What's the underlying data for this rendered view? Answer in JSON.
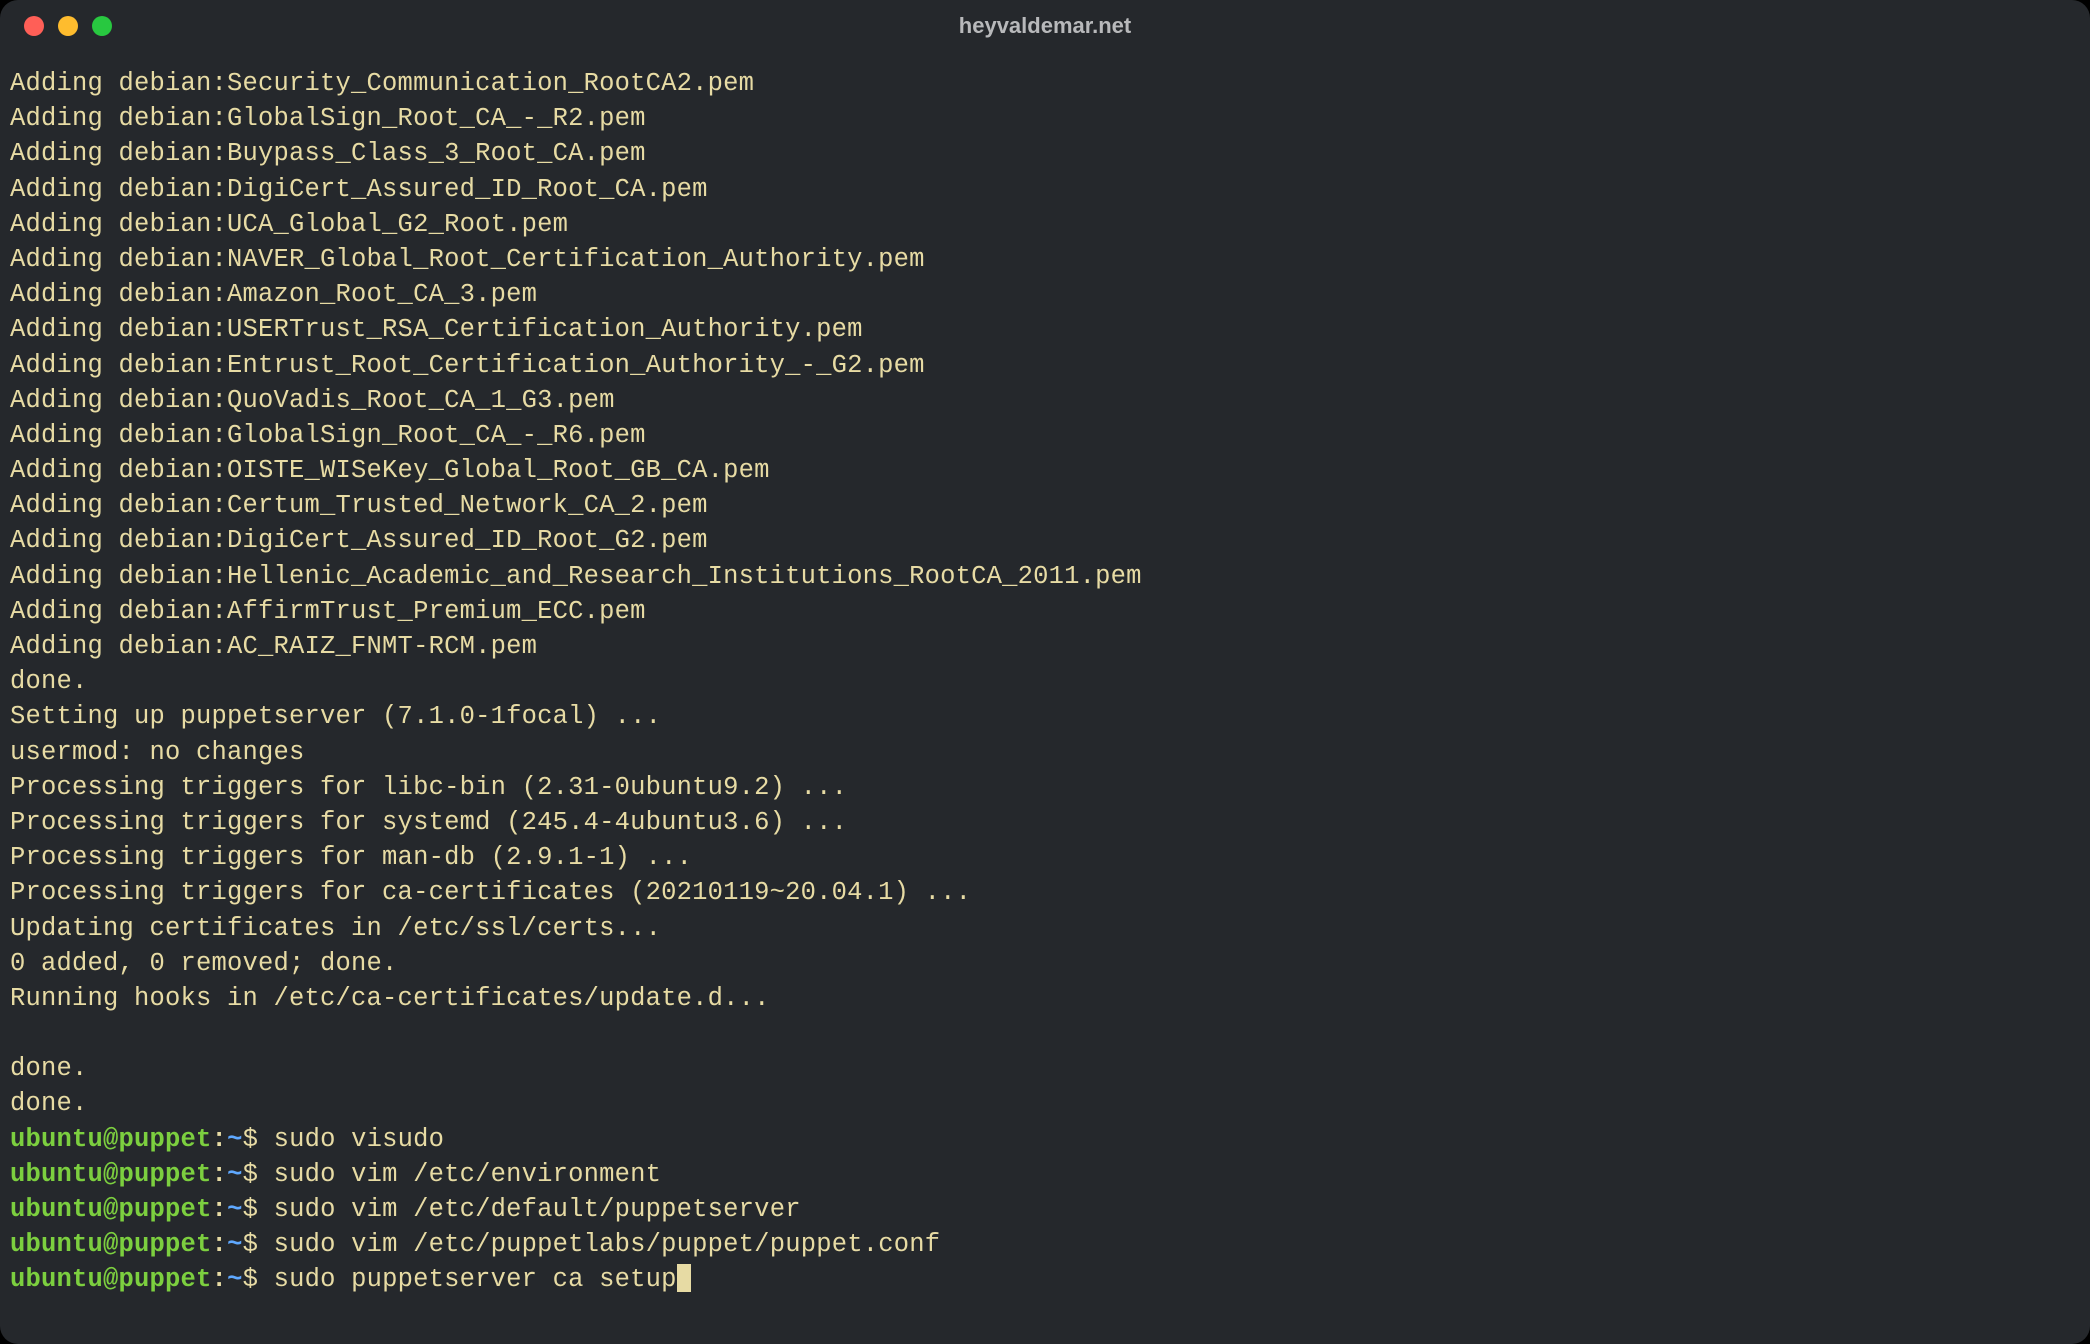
{
  "window": {
    "title": "heyvaldemar.net"
  },
  "output_lines": [
    "Adding debian:Security_Communication_RootCA2.pem",
    "Adding debian:GlobalSign_Root_CA_-_R2.pem",
    "Adding debian:Buypass_Class_3_Root_CA.pem",
    "Adding debian:DigiCert_Assured_ID_Root_CA.pem",
    "Adding debian:UCA_Global_G2_Root.pem",
    "Adding debian:NAVER_Global_Root_Certification_Authority.pem",
    "Adding debian:Amazon_Root_CA_3.pem",
    "Adding debian:USERTrust_RSA_Certification_Authority.pem",
    "Adding debian:Entrust_Root_Certification_Authority_-_G2.pem",
    "Adding debian:QuoVadis_Root_CA_1_G3.pem",
    "Adding debian:GlobalSign_Root_CA_-_R6.pem",
    "Adding debian:OISTE_WISeKey_Global_Root_GB_CA.pem",
    "Adding debian:Certum_Trusted_Network_CA_2.pem",
    "Adding debian:DigiCert_Assured_ID_Root_G2.pem",
    "Adding debian:Hellenic_Academic_and_Research_Institutions_RootCA_2011.pem",
    "Adding debian:AffirmTrust_Premium_ECC.pem",
    "Adding debian:AC_RAIZ_FNMT-RCM.pem",
    "done.",
    "Setting up puppetserver (7.1.0-1focal) ...",
    "usermod: no changes",
    "Processing triggers for libc-bin (2.31-0ubuntu9.2) ...",
    "Processing triggers for systemd (245.4-4ubuntu3.6) ...",
    "Processing triggers for man-db (2.9.1-1) ...",
    "Processing triggers for ca-certificates (20210119~20.04.1) ...",
    "Updating certificates in /etc/ssl/certs...",
    "0 added, 0 removed; done.",
    "Running hooks in /etc/ca-certificates/update.d...",
    "",
    "done.",
    "done."
  ],
  "prompt": {
    "user_host": "ubuntu@puppet",
    "separator": ":",
    "path": "~",
    "symbol": "$"
  },
  "commands": [
    {
      "text": "sudo visudo",
      "cursor": false
    },
    {
      "text": "sudo vim /etc/environment",
      "cursor": false
    },
    {
      "text": "sudo vim /etc/default/puppetserver",
      "cursor": false
    },
    {
      "text": "sudo vim /etc/puppetlabs/puppet/puppet.conf",
      "cursor": false
    },
    {
      "text": "sudo puppetserver ca setup",
      "cursor": true
    }
  ]
}
